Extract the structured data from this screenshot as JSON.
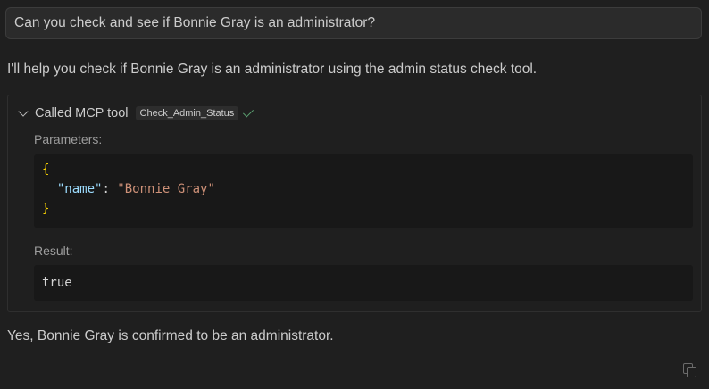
{
  "user_message": "Can you check and see if Bonnie Gray is an administrator?",
  "assistant": {
    "intro": "I'll help you check if Bonnie Gray is an administrator using the admin status check tool.",
    "conclusion": "Yes, Bonnie Gray is confirmed to be an administrator."
  },
  "tool_call": {
    "header_label": "Called MCP tool",
    "tool_name": "Check_Admin_Status",
    "status_icon": "check-icon",
    "parameters_label": "Parameters:",
    "parameters": {
      "open_brace": "{",
      "key": "\"name\"",
      "colon": ": ",
      "value": "\"Bonnie Gray\"",
      "close_brace": "}"
    },
    "result_label": "Result:",
    "result": "true"
  },
  "icons": {
    "collapse": "chevron-down-icon",
    "copy": "copy-icon"
  },
  "colors": {
    "background": "#1f1f1f",
    "json_brace": "#ffd700",
    "json_key": "#9cdcfe",
    "json_string": "#ce9178",
    "success": "#5a9e6f"
  }
}
